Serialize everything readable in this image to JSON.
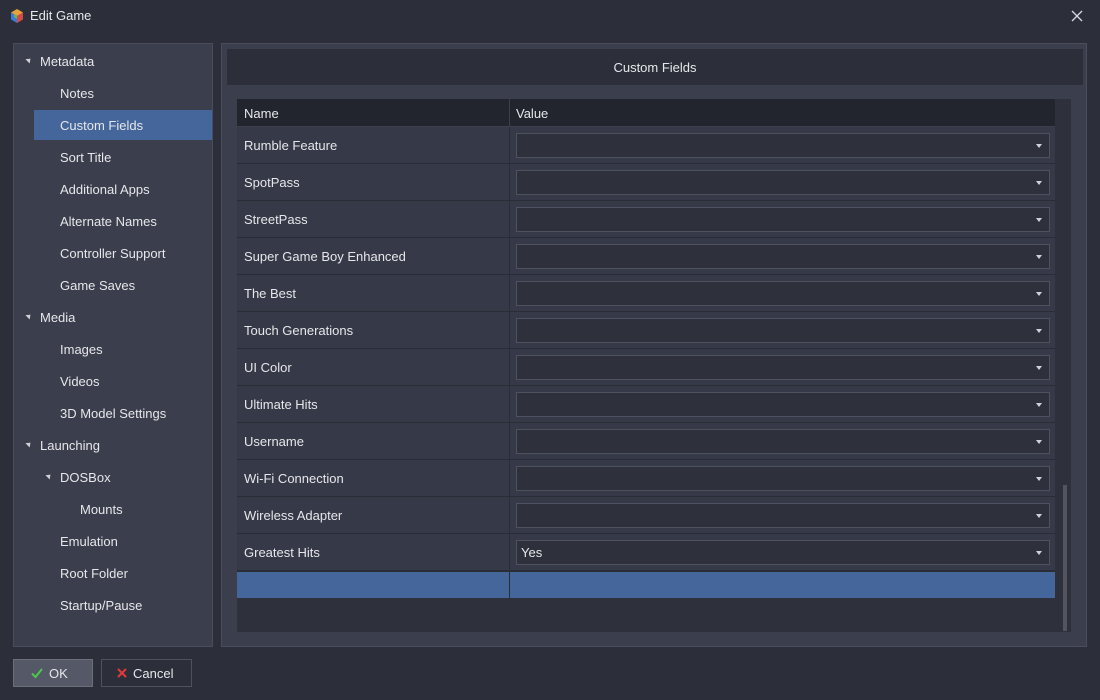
{
  "window": {
    "title": "Edit Game"
  },
  "sidebar": {
    "items": [
      {
        "label": "Metadata",
        "level": 0,
        "expanded": true
      },
      {
        "label": "Notes",
        "level": 1
      },
      {
        "label": "Custom Fields",
        "level": 1,
        "selected": true
      },
      {
        "label": "Sort Title",
        "level": 1
      },
      {
        "label": "Additional Apps",
        "level": 1
      },
      {
        "label": "Alternate Names",
        "level": 1
      },
      {
        "label": "Controller Support",
        "level": 1
      },
      {
        "label": "Game Saves",
        "level": 1
      },
      {
        "label": "Media",
        "level": 0,
        "expanded": true
      },
      {
        "label": "Images",
        "level": 1
      },
      {
        "label": "Videos",
        "level": 1
      },
      {
        "label": "3D Model Settings",
        "level": 1
      },
      {
        "label": "Launching",
        "level": 0,
        "expanded": true
      },
      {
        "label": "DOSBox",
        "level": 1,
        "expanded": true
      },
      {
        "label": "Mounts",
        "level": 2
      },
      {
        "label": "Emulation",
        "level": 1
      },
      {
        "label": "Root Folder",
        "level": 1
      },
      {
        "label": "Startup/Pause",
        "level": 1
      }
    ]
  },
  "main": {
    "header": "Custom Fields",
    "columns": {
      "name": "Name",
      "value": "Value"
    },
    "rows": [
      {
        "name": "Rumble Feature",
        "value": ""
      },
      {
        "name": "SpotPass",
        "value": ""
      },
      {
        "name": "StreetPass",
        "value": ""
      },
      {
        "name": "Super Game Boy Enhanced",
        "value": ""
      },
      {
        "name": "The Best",
        "value": ""
      },
      {
        "name": "Touch Generations",
        "value": ""
      },
      {
        "name": "UI Color",
        "value": ""
      },
      {
        "name": "Ultimate Hits",
        "value": ""
      },
      {
        "name": "Username",
        "value": ""
      },
      {
        "name": "Wi-Fi Connection",
        "value": ""
      },
      {
        "name": "Wireless Adapter",
        "value": ""
      },
      {
        "name": "Greatest Hits",
        "value": "Yes"
      }
    ]
  },
  "buttons": {
    "ok": "OK",
    "cancel": "Cancel"
  },
  "colors": {
    "background": "#2c2f3a",
    "panel": "#3b3e4c",
    "selection": "#45669a",
    "ok_check": "#4cc94c",
    "cancel_x": "#e03a3a"
  },
  "icons": {
    "app": "launchbox-cube-icon",
    "close": "close-icon",
    "ok": "checkmark-icon",
    "cancel": "x-icon",
    "combo": "chevron-down-icon",
    "expander": "expander-triangle-icon"
  }
}
